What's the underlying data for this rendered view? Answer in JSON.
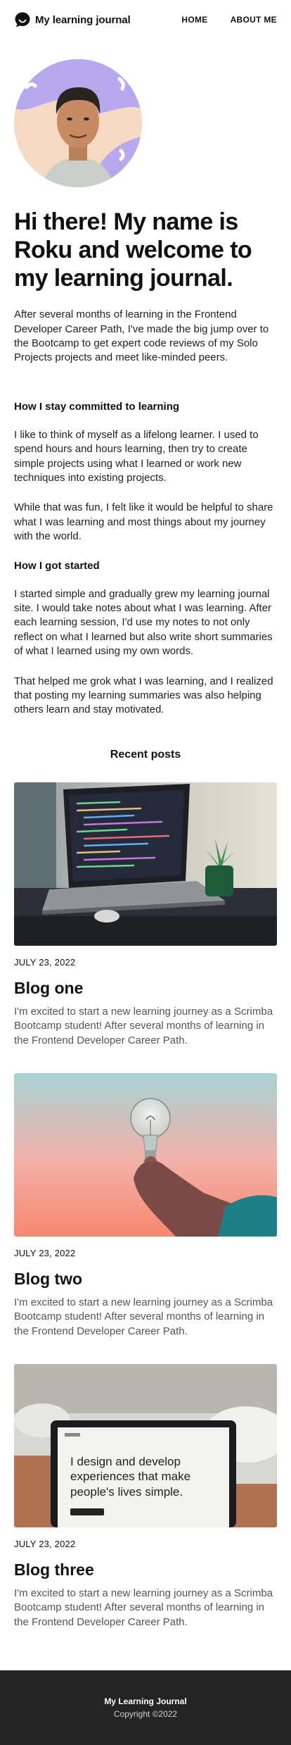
{
  "nav": {
    "brand": "My learning journal",
    "brand_icon": "chat-bubble-smile-icon",
    "links": [
      "HOME",
      "ABOUT ME"
    ]
  },
  "hero": {
    "title": "Hi there! My name is Roku and welcome to my learning journal.",
    "text": "After several months of learning in the Frontend Developer Career Path, I've made the big jump over to the Bootcamp to get expert code reviews of my Solo Projects projects and meet like-minded peers."
  },
  "about": {
    "heading1": "How I stay committed to learning",
    "p1": "I like to think of myself as a lifelong learner. I used to spend hours and hours learning, then try to create simple projects using what I learned or work new techniques into existing projects.",
    "p2": "While that was fun, I felt like it would be helpful to share what I was learning and most things about my journey with the world.",
    "heading2": "How I got started",
    "p3": "I started simple and gradually grew my learning journal site. I would take notes about what I was learning. After each learning session, I'd use my notes to not only reflect on what I learned but also write short summaries of what I learned using my own words.",
    "p4": "That helped me grok what I was learning, and I realized that posting my learning summaries was also helping others learn and stay motivated."
  },
  "recent": {
    "title": "Recent posts",
    "posts": [
      {
        "date": "JULY 23, 2022",
        "title": "Blog one",
        "text": "I'm excited to start a new learning journey as a Scrimba Bootcamp student! After several months of learning in the Frontend Developer Career Path."
      },
      {
        "date": "JULY 23, 2022",
        "title": "Blog two",
        "text": "I'm excited to start a new learning journey as a Scrimba Bootcamp student! After several months of learning in the Frontend Developer Career Path."
      },
      {
        "date": "JULY 23, 2022",
        "title": "Blog three",
        "text": "I'm excited to start a new learning journey as a Scrimba Bootcamp student! After several months of learning in the Frontend Developer Career Path.",
        "image_text": "I design and develop experiences that make people's lives simple."
      }
    ]
  },
  "footer": {
    "title": "My Learning Journal",
    "copyright": "Copyright ©2022"
  }
}
